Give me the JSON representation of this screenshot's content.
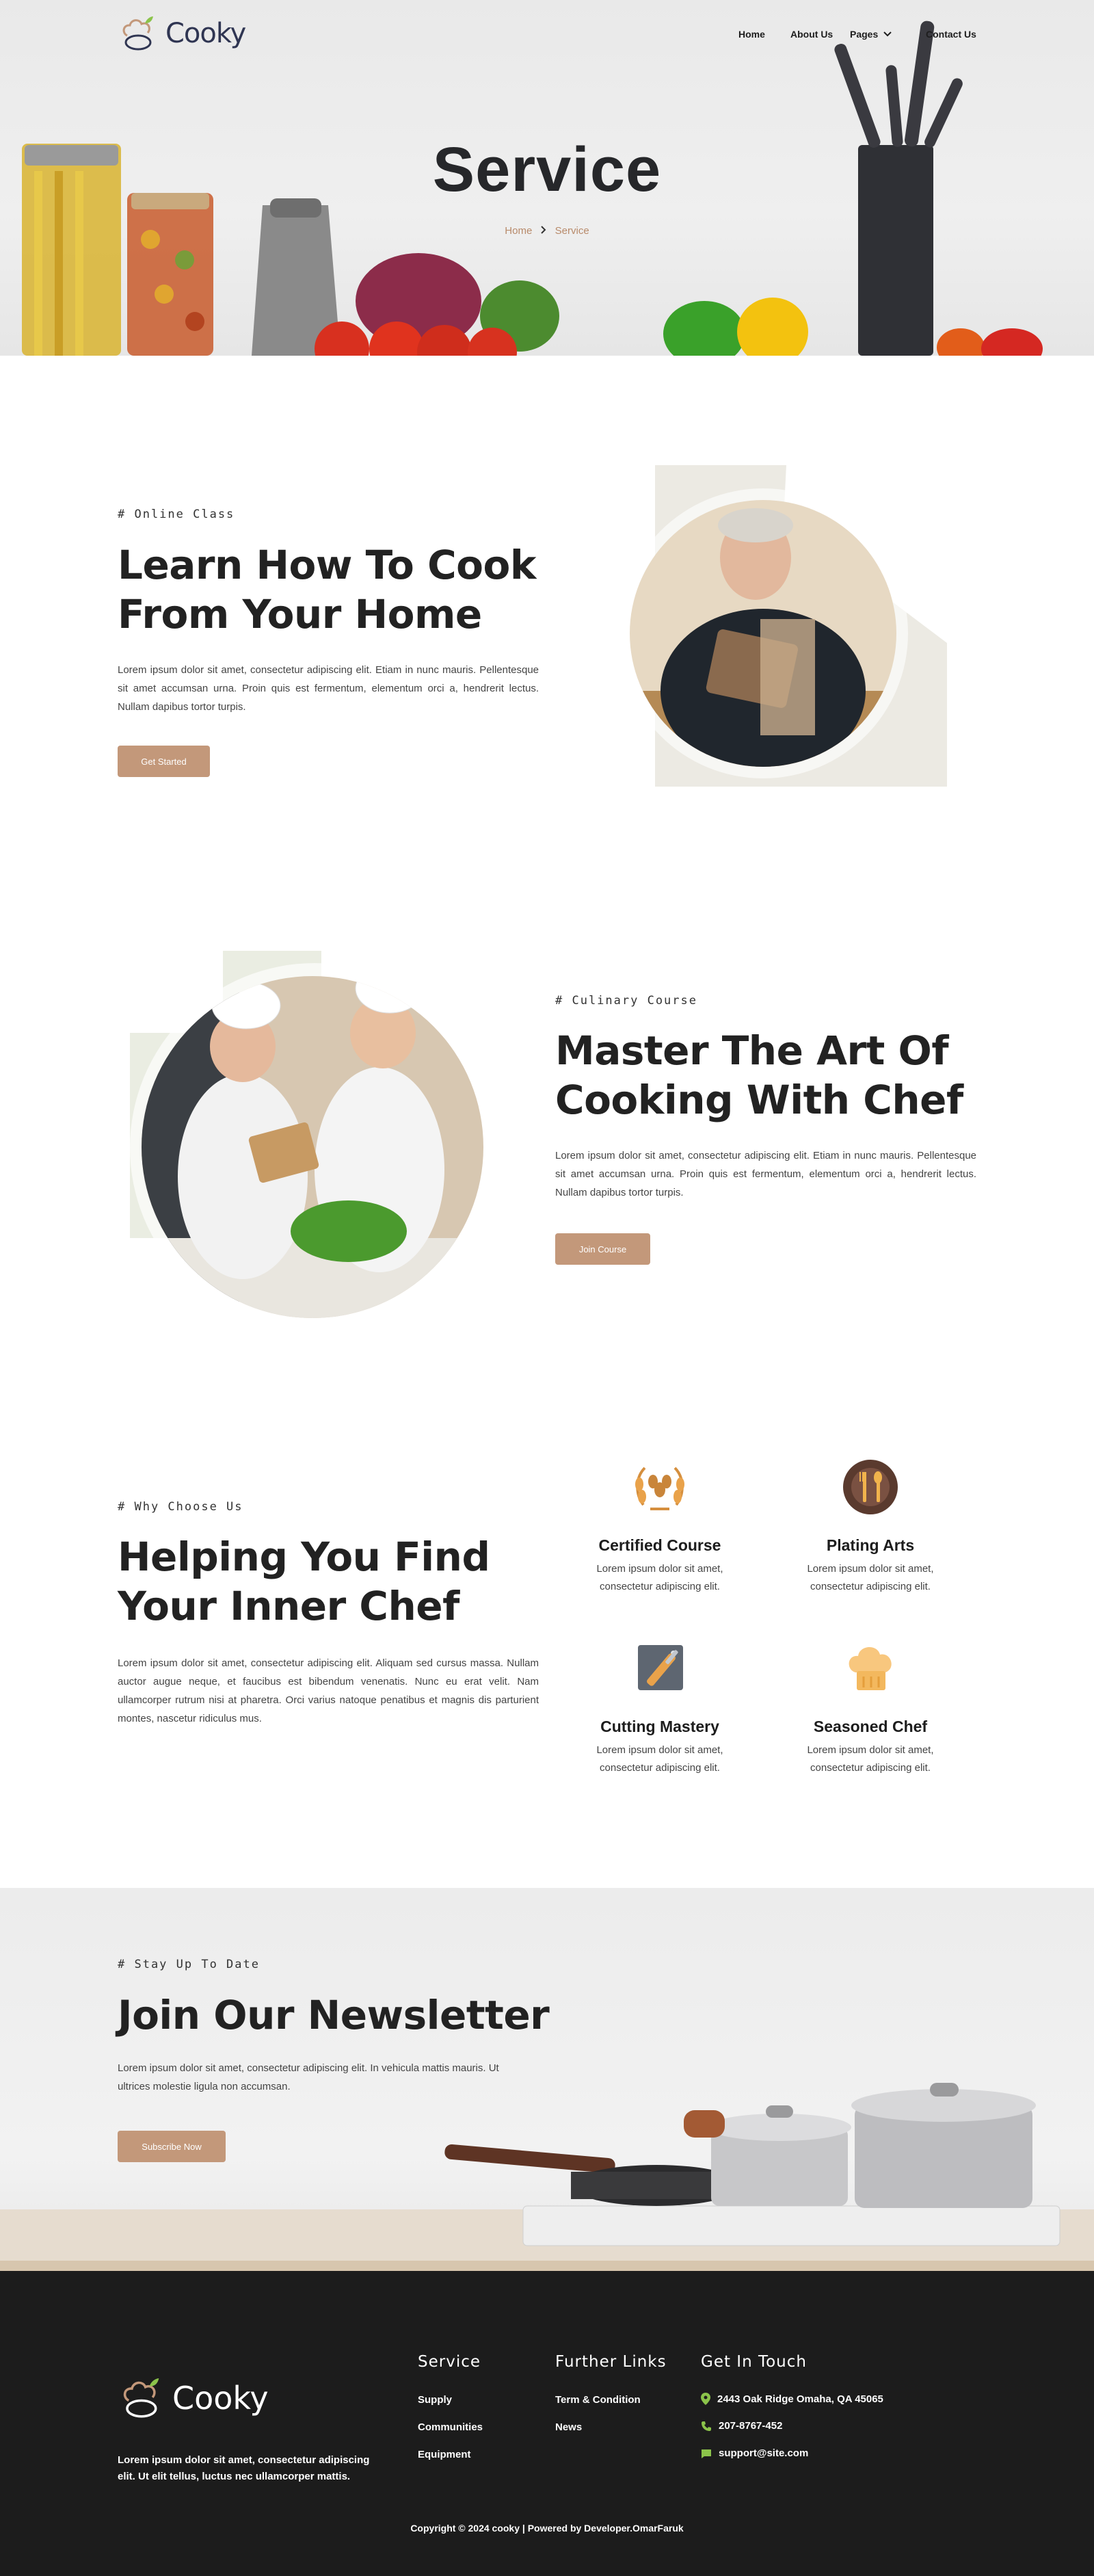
{
  "brand": {
    "name": "Cooky"
  },
  "nav": {
    "home": "Home",
    "about": "About Us",
    "pages": "Pages",
    "contact": "Contact Us"
  },
  "hero": {
    "title": "Service",
    "breadcrumb": {
      "home": "Home",
      "current": "Service"
    }
  },
  "online_class": {
    "eyebrow": "# Online Class",
    "title_line1": "Learn How To Cook",
    "title_line2": "From Your Home",
    "body": "Lorem ipsum dolor sit amet, consectetur adipiscing elit. Etiam in nunc mauris. Pellentesque sit amet accumsan urna. Proin quis est fermentum, elementum orci a, hendrerit lectus. Nullam dapibus tortor turpis.",
    "button": "Get Started"
  },
  "culinary_course": {
    "eyebrow": "# Culinary Course",
    "title_line1": "Master The Art Of",
    "title_line2": "Cooking With Chef",
    "body": "Lorem ipsum dolor sit amet, consectetur adipiscing elit. Etiam in nunc mauris. Pellentesque sit amet accumsan urna. Proin quis est fermentum, elementum orci a, hendrerit lectus. Nullam dapibus tortor turpis.",
    "button": "Join Course"
  },
  "why_choose": {
    "eyebrow": "# Why Choose Us",
    "title_line1": "Helping You Find",
    "title_line2": "Your Inner Chef",
    "body": "Lorem ipsum dolor sit amet, consectetur adipiscing elit. Aliquam sed cursus massa. Nullam auctor augue neque, et faucibus est bibendum venenatis. Nunc eu erat velit. Nam ullamcorper rutrum nisi at pharetra. Orci varius natoque penatibus et magnis dis parturient montes, nascetur ridiculus mus.",
    "features": [
      {
        "title": "Certified Course",
        "desc_line1": "Lorem ipsum dolor sit amet,",
        "desc_line2": "consectetur adipiscing elit.",
        "icon": "laurel-wreath-icon"
      },
      {
        "title": "Plating Arts",
        "desc_line1": "Lorem ipsum dolor sit amet,",
        "desc_line2": "consectetur adipiscing elit.",
        "icon": "plate-cutlery-icon"
      },
      {
        "title": "Cutting Mastery",
        "desc_line1": "Lorem ipsum dolor sit amet,",
        "desc_line2": "consectetur adipiscing elit.",
        "icon": "cutting-board-knife-icon"
      },
      {
        "title": "Seasoned Chef",
        "desc_line1": "Lorem ipsum dolor sit amet,",
        "desc_line2": "consectetur adipiscing elit.",
        "icon": "chef-hat-icon"
      }
    ]
  },
  "newsletter": {
    "eyebrow": "# Stay Up To Date",
    "title": "Join Our Newsletter",
    "body_line1": "Lorem ipsum dolor sit amet, consectetur adipiscing elit. In vehicula mattis mauris. Ut",
    "body_line2": "ultrices molestie ligula non accumsan.",
    "button": "Subscribe Now"
  },
  "footer": {
    "about_line1": "Lorem ipsum dolor sit amet, consectetur adipiscing",
    "about_line2": "elit. Ut elit tellus, luctus nec ullamcorper mattis.",
    "service": {
      "title": "Service",
      "links": [
        "Supply",
        "Communities",
        "Equipment"
      ]
    },
    "further": {
      "title": "Further Links",
      "links": [
        "Term & Condition",
        "News"
      ]
    },
    "contact": {
      "title": "Get In Touch",
      "address": "2443 Oak Ridge Omaha, QA 45065",
      "phone": "207-8767-452",
      "email": "support@site.com"
    },
    "copyright": "Copyright © 2024 cooky | Powered by Developer.OmarFaruk"
  },
  "colors": {
    "accent": "#c3987a",
    "dark": "#1c1c1c",
    "contact_icon": "#8bc34a",
    "brand_text": "#2f3552"
  }
}
